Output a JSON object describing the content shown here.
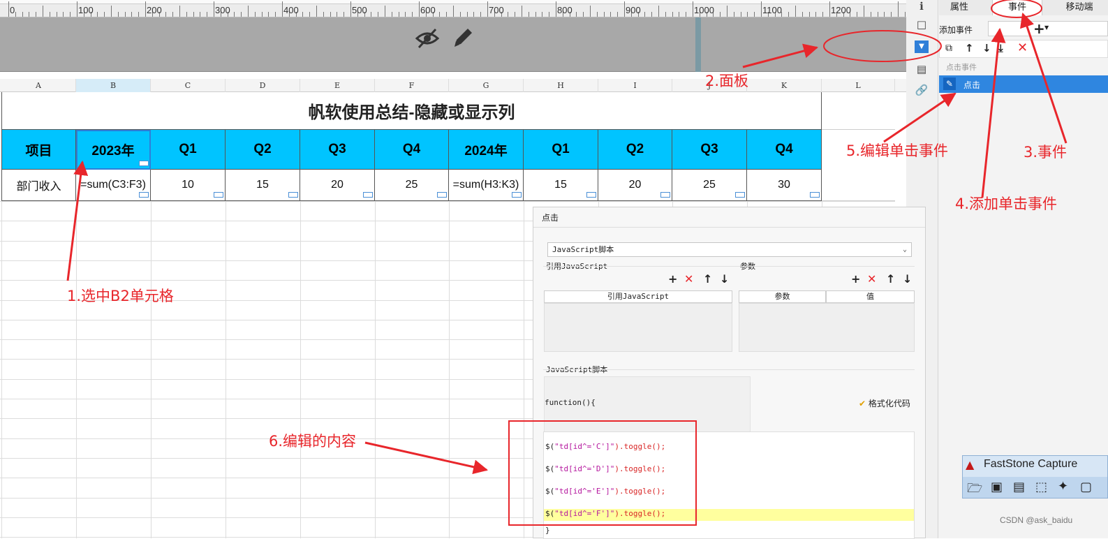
{
  "ruler": {
    "labels": [
      "0",
      "100",
      "200",
      "300",
      "400",
      "500",
      "600",
      "700",
      "800",
      "900",
      "1000",
      "1100",
      "1200"
    ]
  },
  "columns": [
    "A",
    "B",
    "C",
    "D",
    "E",
    "F",
    "G",
    "H",
    "I",
    "J",
    "K",
    "L"
  ],
  "sheet": {
    "title": "帆软使用总结-隐藏或显示列",
    "header_row": [
      "项目",
      "2023年",
      "Q1",
      "Q2",
      "Q3",
      "Q4",
      "2024年",
      "Q1",
      "Q2",
      "Q3",
      "Q4"
    ],
    "data_row": [
      "部门收入",
      "=sum(C3:F3)",
      "10",
      "15",
      "20",
      "25",
      "=sum(H3:K3)",
      "15",
      "20",
      "25",
      "30"
    ]
  },
  "right_panel": {
    "tabs": [
      "属性",
      "事件",
      "移动端"
    ],
    "add_event_label": "添加事件",
    "event_section_label": "点击事件",
    "event_item": "点击"
  },
  "dialog": {
    "title": "点击",
    "type_select": "JavaScript脚本",
    "ref_js_label": "引用JavaScript",
    "params_label": "参数",
    "ref_js_col": "引用JavaScript",
    "param_col": "参数",
    "value_col": "值",
    "script_label": "JavaScript脚本",
    "function_line": "function(){",
    "format_code": "格式化代码",
    "code_lines": [
      {
        "pre": "$(",
        "str": "\"td[id^='C']\"",
        "post": ").toggle();"
      },
      {
        "pre": "$(",
        "str": "\"td[id^='D']\"",
        "post": ").toggle();"
      },
      {
        "pre": "$(",
        "str": "\"td[id^='E']\"",
        "post": ").toggle();"
      },
      {
        "pre": "$(",
        "str": "\"td[id^='F']\"",
        "post": ").toggle();"
      }
    ],
    "closing_brace": "}"
  },
  "annotations": {
    "a1": "1.选中B2单元格",
    "a2": "2.面板",
    "a3": "3.事件",
    "a4": "4.添加单击事件",
    "a5": "5.编辑单击事件",
    "a6": "6.编辑的内容"
  },
  "faststone": {
    "title": "FastStone Capture"
  },
  "watermark": "CSDN @ask_baidu",
  "colors": {
    "header_fill": "#00c4ff",
    "annotation": "#e8262b",
    "highlight_line": "#ffff9e"
  }
}
